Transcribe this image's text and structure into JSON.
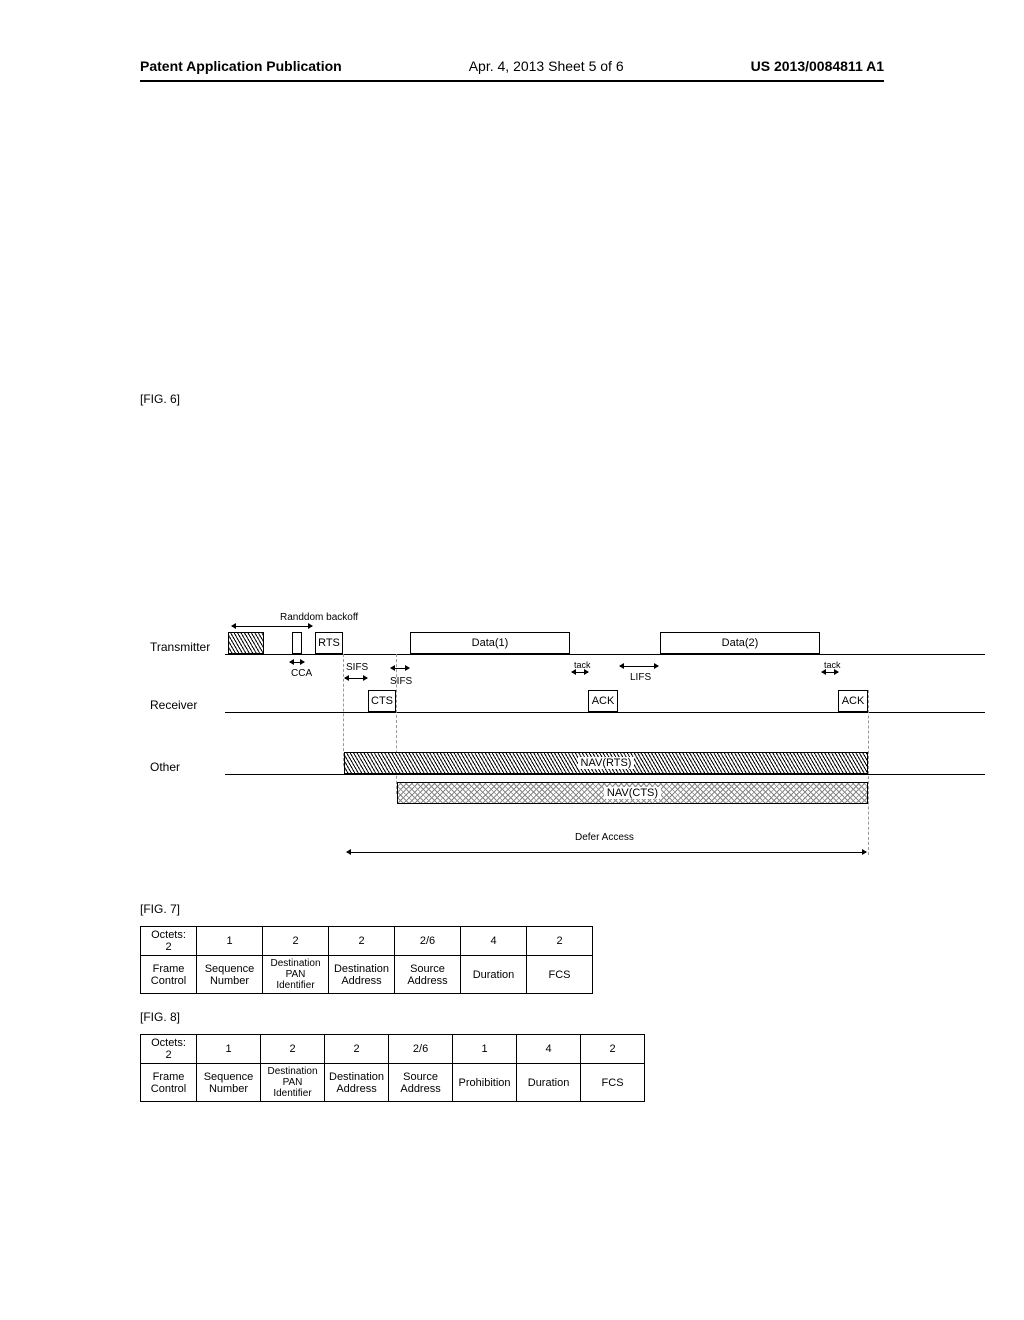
{
  "header": {
    "left": "Patent Application Publication",
    "center": "Apr. 4, 2013  Sheet 5 of 6",
    "right": "US 2013/0084811 A1"
  },
  "fig6": {
    "label": "[FIG. 6]",
    "backoff": "Randdom backoff",
    "transmitter": "Transmitter",
    "receiver": "Receiver",
    "other": "Other",
    "rts": "RTS",
    "cts": "CTS",
    "cca": "CCA",
    "sifs": "SIFS",
    "tack": "tack",
    "lifs": "LIFS",
    "data1": "Data(1)",
    "data2": "Data(2)",
    "ack": "ACK",
    "navrts": "NAV(RTS)",
    "navcts": "NAV(CTS)",
    "defer": "Defer Access"
  },
  "fig7": {
    "label": "[FIG. 7]",
    "octets_label": "Octets:",
    "oct0": "2",
    "oct1": "1",
    "oct2": "2",
    "oct3": "2",
    "oct4": "2/6",
    "oct5": "4",
    "oct6": "2",
    "f0": "Frame Control",
    "f1": "Sequence Number",
    "f2": "Destination PAN Identifier",
    "f3": "Destination Address",
    "f4": "Source Address",
    "f5": "Duration",
    "f6": "FCS"
  },
  "fig8": {
    "label": "[FIG. 8]",
    "octets_label": "Octets:",
    "oct0": "2",
    "oct1": "1",
    "oct2": "2",
    "oct3": "2",
    "oct4": "2/6",
    "oct5": "1",
    "oct6": "4",
    "oct7": "2",
    "f0": "Frame Control",
    "f1": "Sequence Number",
    "f2": "Destination PAN Identifier",
    "f3": "Destination Address",
    "f4": "Source Address",
    "f5": "Prohibition",
    "f6": "Duration",
    "f7": "FCS"
  }
}
